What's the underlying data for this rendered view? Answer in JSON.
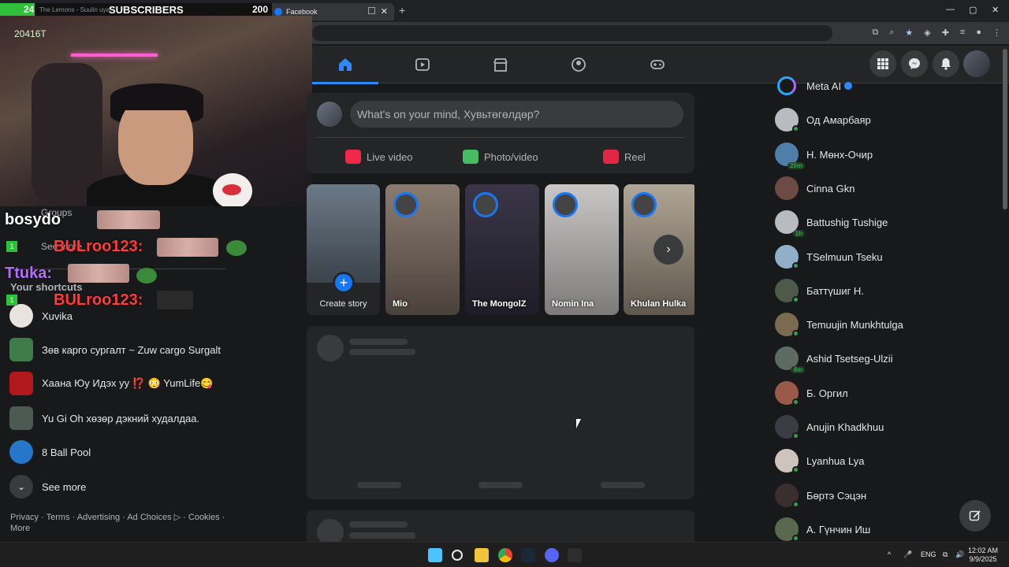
{
  "browser": {
    "active_tab": "Facebook",
    "inactive_tab": "The Lemons - Suulin uya",
    "new_tab_label": "+",
    "window_controls": [
      "—",
      "▢",
      "✕"
    ]
  },
  "stream": {
    "sub_count": "24",
    "sub_title": "SUBSCRIBERS",
    "sub_goal": "200",
    "viewer_text": "20416T",
    "chat": [
      {
        "user": "bosydo",
        "color": "#ffffff"
      },
      {
        "user": "BULroo123:",
        "color": "#ff3b3b"
      },
      {
        "user": "Ttuka:",
        "color": "#b46cff"
      },
      {
        "user": "BULroo123:",
        "color": "#ff3b3b"
      }
    ]
  },
  "sidebar": {
    "ghost_groups": "Groups",
    "ghost_see_more": "See more",
    "ghost_shortcuts": "Your shortcuts",
    "shortcuts": [
      {
        "label": "Xuvika",
        "color": "#e9e3df"
      },
      {
        "label": "Зөв карго сургалт ~ Zuw cargo Surgalt",
        "color": "#3f7a4a"
      },
      {
        "label": "Хаана Юу Идэх уу ⁉️ 😳 YumLife😋",
        "color": "#b3181f"
      },
      {
        "label": "Yu Gi Oh хөзөр дэкний худалдаа.",
        "color": "#4a5a52"
      },
      {
        "label": "8 Ball Pool",
        "color": "#2677c9"
      }
    ],
    "see_more": "See more",
    "footer": "Privacy · Terms · Advertising · Ad Choices ▷ · Cookies · More"
  },
  "composer": {
    "placeholder": "What's on your mind, Хувьтөгөлдөр?",
    "live": "Live video",
    "photo": "Photo/video",
    "reel": "Reel",
    "live_color": "#f02849",
    "photo_color": "#45bd62",
    "reel_color": "#e42645"
  },
  "stories": {
    "create_label": "Create story",
    "items": [
      {
        "name": "Mio",
        "color": "#6b6058"
      },
      {
        "name": "The MongolZ",
        "color": "#2c2a36"
      },
      {
        "name": "Nomin Ina",
        "color": "#a7a4a4"
      },
      {
        "name": "Khulan Hulka",
        "color": "#8d857b"
      }
    ]
  },
  "contacts": [
    {
      "name": "Meta AI",
      "verified": true,
      "status": "none",
      "color": "#18191a"
    },
    {
      "name": "Од Амарбаяр",
      "status": "online",
      "color": "#b8bbbf"
    },
    {
      "name": "Н. Мөнх-Очир",
      "status": "time",
      "time": "20m",
      "color": "#4f7fa8"
    },
    {
      "name": "Cinna Gkn",
      "status": "none",
      "color": "#6e4a44"
    },
    {
      "name": "Battushig Tushige",
      "status": "time",
      "time": "1h",
      "color": "#b8bbbf"
    },
    {
      "name": "TSelmuun Tseku",
      "status": "online",
      "color": "#8fb0c8"
    },
    {
      "name": "Баттүшиг Н.",
      "status": "online",
      "color": "#4d5a4a"
    },
    {
      "name": "Temuujin Munkhtulga",
      "status": "online",
      "color": "#7a6a50"
    },
    {
      "name": "Ashid Tsetseg-Ulzii",
      "status": "time",
      "time": "4m",
      "color": "#5d6a62"
    },
    {
      "name": "Б. Оргил",
      "status": "online",
      "color": "#9a5a4a"
    },
    {
      "name": "Anujin Khadkhuu",
      "status": "online",
      "color": "#3c3c44"
    },
    {
      "name": "Lyanhua Lya",
      "status": "online",
      "color": "#cfc4bd"
    },
    {
      "name": "Бөртэ Сэцэн",
      "status": "online",
      "color": "#3a2e2e"
    },
    {
      "name": "А. Гүнчин Иш",
      "status": "online",
      "color": "#5a6850"
    }
  ],
  "taskbar": {
    "lang": "ENG",
    "time": "12:02 AM",
    "date": "9/9/2025"
  }
}
